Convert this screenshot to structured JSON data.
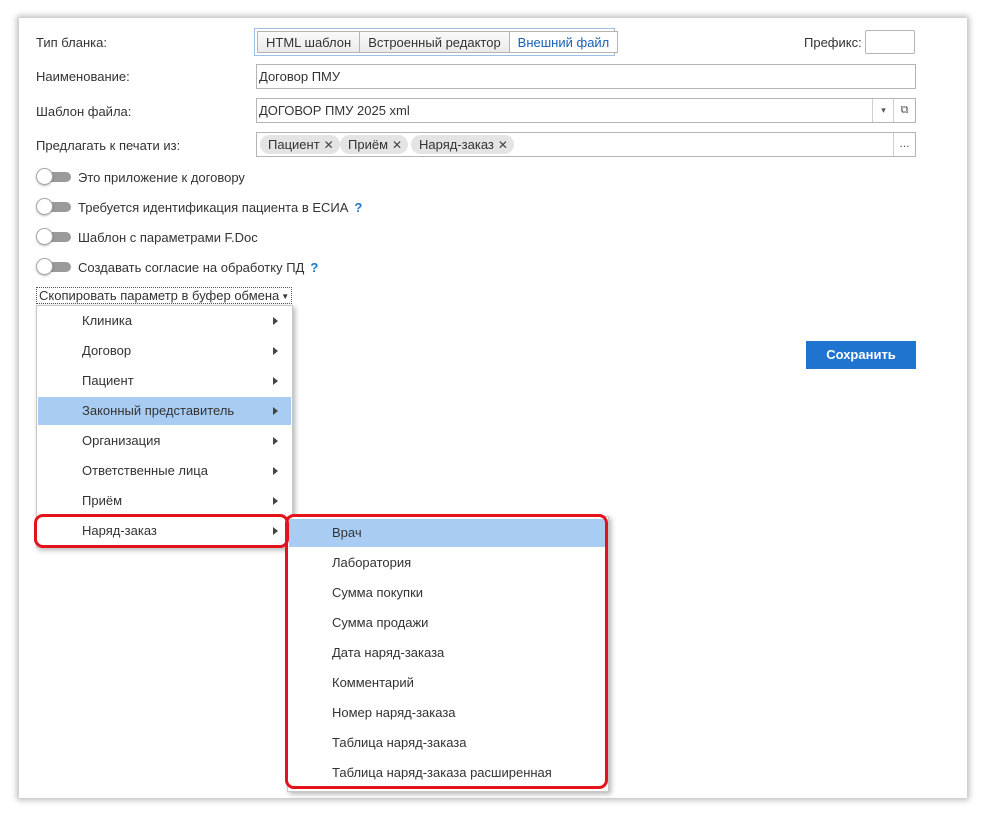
{
  "form": {
    "blank_type_label": "Тип бланка:",
    "blank_type_options": [
      "HTML шаблон",
      "Встроенный редактор",
      "Внешний файл"
    ],
    "blank_type_selected": "Внешний файл",
    "prefix_label": "Префикс:",
    "prefix_value": "",
    "name_label": "Наименование:",
    "name_value": "Договор ПМУ",
    "template_label": "Шаблон файла:",
    "template_value": "ДОГОВОР ПМУ 2025 xml",
    "print_from_label": "Предлагать к печати из:",
    "print_from_tags": [
      "Пациент",
      "Приём",
      "Наряд-заказ"
    ],
    "more_button": "...",
    "toggles": [
      {
        "label": "Это приложение к договору",
        "on": false,
        "help": ""
      },
      {
        "label": "Требуется идентификация пациента в ЕСИА",
        "on": false,
        "help": "?"
      },
      {
        "label": "Шаблон с параметрами F.Doc",
        "on": false,
        "help": ""
      },
      {
        "label": "Создавать согласие на обработку ПД",
        "on": false,
        "help": "?"
      }
    ],
    "copy_param_label": "Скопировать параметр в буфер обмена",
    "save_button": "Сохранить"
  },
  "menu": {
    "items": [
      "Клиника",
      "Договор",
      "Пациент",
      "Законный представитель",
      "Организация",
      "Ответственные лица",
      "Приём",
      "Наряд-заказ"
    ],
    "highlighted": "Законный представитель"
  },
  "submenu": {
    "items": [
      "Врач",
      "Лаборатория",
      "Сумма покупки",
      "Сумма продажи",
      "Дата наряд-заказа",
      "Комментарий",
      "Номер наряд-заказа",
      "Таблица наряд-заказа",
      "Таблица наряд-заказа расширенная"
    ],
    "highlighted": "Врач"
  },
  "colors": {
    "accent": "#1e74cf",
    "highlight": "#a9cdf2",
    "annotation": "#e3121b"
  }
}
